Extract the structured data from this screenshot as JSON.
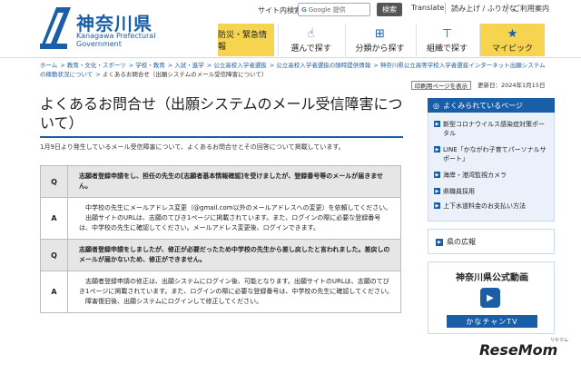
{
  "header": {
    "logo_title": "神奈川県",
    "logo_subtitle": "Kanagawa Prefectural Government",
    "site_search_label": "サイト内検索",
    "search_placeholder": "Google 提供",
    "search_button": "検索",
    "translate": "Translate",
    "furigana": "読み上げ / ふりがな",
    "usage": "ご利用案内"
  },
  "nav": [
    {
      "label": "防災・緊急情報",
      "icon": "warning-icon"
    },
    {
      "label": "選んで探す",
      "icon": "hand-pointer-icon"
    },
    {
      "label": "分類から探す",
      "icon": "tree-icon"
    },
    {
      "label": "組織で探す",
      "icon": "org-chart-icon"
    },
    {
      "label": "マイピック",
      "icon": "star-icon"
    }
  ],
  "breadcrumb": [
    "ホーム",
    "教育・文化・スポーツ",
    "学校・教育",
    "入試・進学",
    "公立高校入学者選抜",
    "公立高校入学者選抜の随時提供情報",
    "神奈川県公立高等学校入学者選抜インターネット出願システムの稼動状況について",
    "よくあるお問合せ（出願システムのメール受信障害について）"
  ],
  "main": {
    "print_button": "印刷用ページを表示",
    "updated": "更新日：2024年1月15日",
    "title": "よくあるお問合せ（出願システムのメール受信障害について）",
    "intro": "1月9日より発生しているメール受信障害について、よくあるお問合せとその回答について掲載しています。",
    "faq": [
      {
        "q_label": "Q",
        "question": "志願者登録申請をし、担任の先生の[志願者基本情報確認]を受けましたが、登録番号等のメールが届きません。",
        "a_label": "A",
        "answer": [
          "中学校の先生にメールアドレス変更（@gmail.com以外のメールアドレスへの変更）を依頼してください。",
          "出願サイトのURLは、志願のてびき1ページに掲載されています。また、ログインの際に必要な登録番号は、中学校の先生に確認してください。メールアドレス変更後、ログインできます。"
        ]
      },
      {
        "q_label": "Q",
        "question": "志願者登録申請をしましたが、修正が必要だったため中学校の先生から差し戻したと言われました。差戻しのメールが届かないため、修正ができません。",
        "a_label": "A",
        "answer": [
          "志願者登録申請の修正は、出願システムにログイン後、可能となります。出願サイトのURLは、志願のてびき1ページに掲載されています。また、ログインの際に必要な登録番号は、中学校の先生に確認してください。",
          "障害復旧後、出願システムにログインして修正してください。"
        ]
      }
    ]
  },
  "sidebar": {
    "heading": "よくみられているページ",
    "items": [
      "新型コロナウイルス感染症対策ポータル",
      "LINE「かながわ子育てパーソナルサポート」",
      "海岸・港湾監視カメラ",
      "県職員採用",
      "上下水道料金のお支払い方法"
    ],
    "kenpo": "県の広報",
    "video_title": "神奈川県公式動画",
    "video_channel": "かなチャンTV"
  },
  "watermark": "ReseMom",
  "watermark_sub": "リセマム"
}
